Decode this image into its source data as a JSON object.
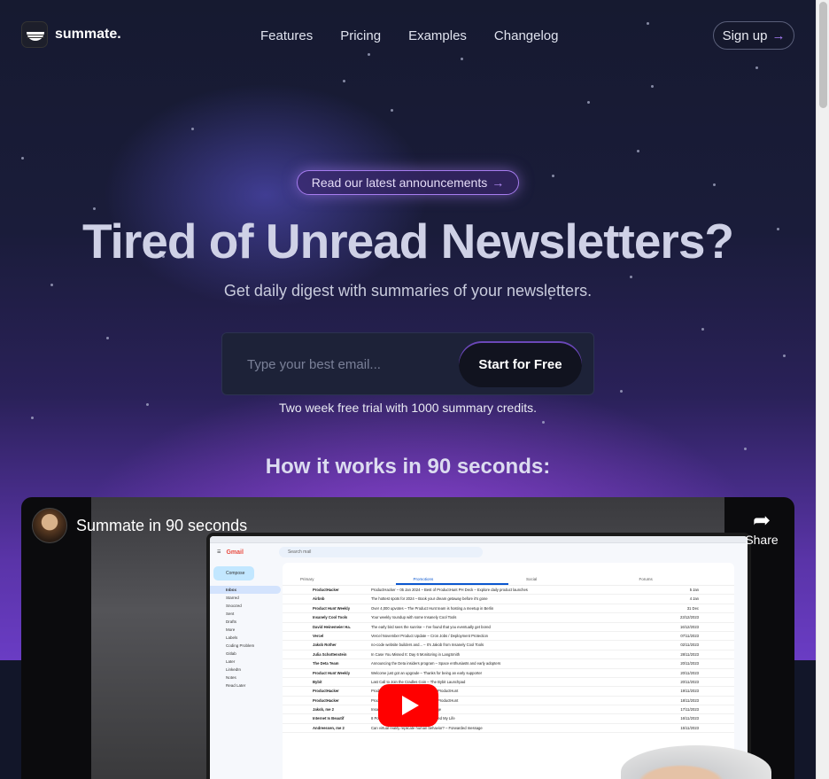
{
  "brand": {
    "name": "summate."
  },
  "nav": {
    "items": [
      "Features",
      "Pricing",
      "Examples",
      "Changelog"
    ]
  },
  "header": {
    "signup_label": "Sign up",
    "signup_arrow": "→"
  },
  "announcement": {
    "label": "Read our latest announcements",
    "arrow": "→"
  },
  "hero": {
    "headline": "Tired of Unread Newsletters?",
    "subheadline": "Get daily digest with summaries of your newsletters."
  },
  "signup_form": {
    "email_placeholder": "Type your best email...",
    "email_value": "",
    "cta_label": "Start for Free",
    "trial_note": "Two week free trial with 1000 summary credits."
  },
  "how_it_works": {
    "title": "How it works in 90 seconds:"
  },
  "video": {
    "title": "Summate in 90 seconds",
    "share_label": "Share",
    "gmail": {
      "app_name": "Gmail",
      "search_placeholder": "Search mail",
      "compose_label": "Compose",
      "side_items": [
        "Inbox",
        "Starred",
        "Snoozed",
        "Sent",
        "Drafts",
        "More",
        "Labels",
        "Coding Problem",
        "Gitlab",
        "Later",
        "LinkedIn",
        "Notes",
        "Read Later"
      ],
      "tabs": [
        "Primary",
        "Promotions",
        "Social",
        "Forums"
      ],
      "rows": [
        {
          "sender": "ProductHacker",
          "subject": "ProductHacker – 05 Jan 2024 – Best of ProductHunt PH Deck – Explore daily product launches",
          "date": "5 Jan"
        },
        {
          "sender": "Airbnb",
          "subject": "The hottest spots for 2024 – Book your dream getaway before it's gone",
          "date": "4 Jan"
        },
        {
          "sender": "Product Hunt Weekly",
          "subject": "Over 4,000 upvotes – The Product Hunt team is hosting a meetup in Berlin",
          "date": "31 Dec"
        },
        {
          "sender": "Insanely Cool Tools",
          "subject": "Your weekly roundup with some Insanely Cool Tools",
          "date": "23/12/2023"
        },
        {
          "sender": "David Heinemeier Ha.",
          "subject": "The early bird sees the sunrise – I've found that you eventually get bored",
          "date": "16/12/2023"
        },
        {
          "sender": "Vercel",
          "subject": "Vercel November Product Update – Cron Jobs / Deployment Protection",
          "date": "07/11/2023"
        },
        {
          "sender": "Jakob Rother",
          "subject": "no-code website builders and... – It's Jakob from Insanely Cool Tools",
          "date": "02/11/2023"
        },
        {
          "sender": "Julia Schottenstein",
          "subject": "In Case You Missed It: Day 6 Monitoring in LangSmith",
          "date": "28/11/2023"
        },
        {
          "sender": "The Deta Team",
          "subject": "Announcing the Deta insiders program – Space enthusiasts and early adopters",
          "date": "20/11/2023"
        },
        {
          "sender": "Product Hunt Weekly",
          "subject": "Welcome just got an upgrade – Thanks for being an early supporter",
          "date": "20/11/2023"
        },
        {
          "sender": "Bybit",
          "subject": "Last Call to Join the Cradles Coin – The Bybit Launchpad",
          "date": "20/11/2023"
        },
        {
          "sender": "ProductHacker",
          "subject": "ProductHacker – 19 Nov 2023 – Best of ProductHunt",
          "date": "19/11/2023"
        },
        {
          "sender": "ProductHacker",
          "subject": "ProductHacker – 18 Nov 2023 – Best of ProductHunt",
          "date": "18/11/2023"
        },
        {
          "sender": "Jakob, me 2",
          "subject": "Insanely Cool Tools – Forwarded message",
          "date": "17/11/2023"
        },
        {
          "sender": "Internet Is Beautif",
          "subject": "8 Powerful Laws of Success That Changed My Life",
          "date": "16/11/2023"
        },
        {
          "sender": "Andreessen, me 2",
          "subject": "Can virtual reality replicate human behavior? – Forwarded message",
          "date": "15/11/2023"
        }
      ]
    }
  },
  "colors": {
    "accent": "#a77df0",
    "background": "#0f1222",
    "youtube_red": "#ff0000"
  },
  "icons": [
    "logo-icon",
    "arrow-right-icon",
    "share-icon",
    "play-icon",
    "avatar"
  ]
}
